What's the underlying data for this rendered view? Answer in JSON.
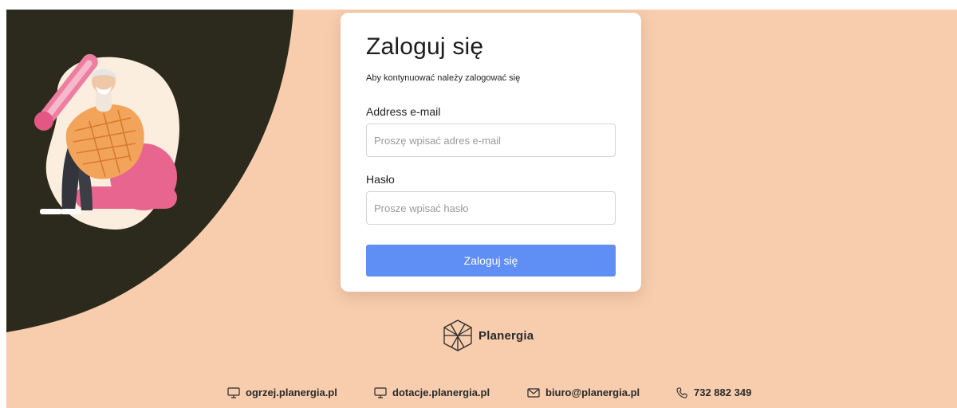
{
  "login": {
    "title": "Zaloguj się",
    "subtitle": "Aby kontynuować należy zalogować się",
    "email_label": "Address e-mail",
    "email_placeholder": "Proszę wpisać adres e-mail",
    "email_value": "",
    "password_label": "Hasło",
    "password_placeholder": "Prosze wpisać hasło",
    "password_value": "",
    "submit_label": "Zaloguj się"
  },
  "brand": {
    "name": "Planergia"
  },
  "footer": {
    "links": [
      {
        "icon": "monitor-icon",
        "label": "ogrzej.planergia.pl"
      },
      {
        "icon": "monitor-icon",
        "label": "dotacje.planergia.pl"
      },
      {
        "icon": "mail-icon",
        "label": "biuro@planergia.pl"
      },
      {
        "icon": "phone-icon",
        "label": "732 882 349"
      }
    ]
  },
  "colors": {
    "background": "#f7cdae",
    "dark_shape": "#2b2a1c",
    "button": "#5f8ff5",
    "card": "#ffffff"
  }
}
